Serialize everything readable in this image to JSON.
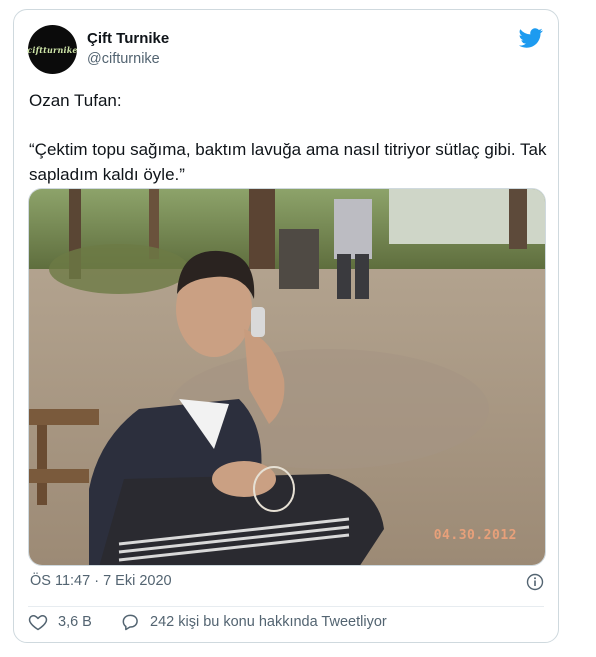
{
  "tweet": {
    "display_name": "Çift Turnike",
    "handle": "@cifturnike",
    "avatar_text": "ciftturnike",
    "text_line1": "Ozan Tufan:",
    "text_line2": "“Çektim topu sağıma, baktım lavuğa ama nasıl titriyor sütlaç gibi. Tak sapladım kaldı öyle.”",
    "timestamp": "ÖS 11:47 · 7 Eki 2020",
    "photo_date_stamp": "04.30.2012",
    "likes_count": "3,6 B",
    "talking_text": "242 kişi bu konu hakkında Tweetliyor"
  },
  "colors": {
    "twitter_blue": "#1d9bf0",
    "secondary_text": "#536471",
    "border": "#cfd9de"
  },
  "icons": {
    "brand": "twitter-bird-icon",
    "info": "info-icon",
    "like": "heart-icon",
    "reply": "speech-bubble-icon"
  }
}
